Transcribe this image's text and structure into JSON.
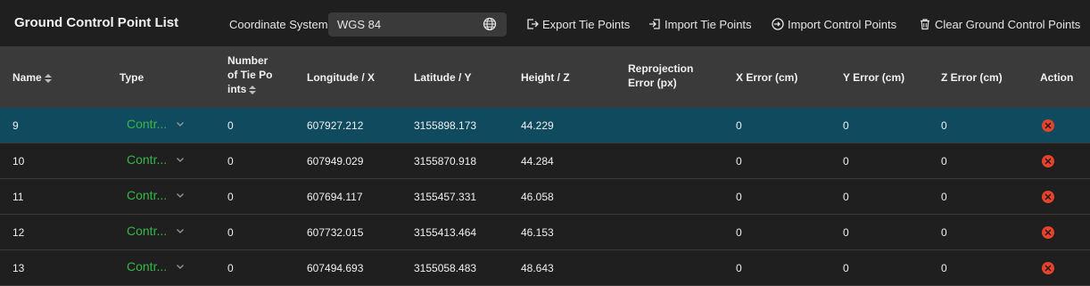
{
  "panel": {
    "title": "Ground Control Point List",
    "coordinate_label": "Coordinate System:",
    "coordinate_value": "WGS 84"
  },
  "toolbar": {
    "export_tie": "Export Tie Points",
    "import_tie": "Import Tie Points",
    "import_control": "Import Control Points",
    "clear_gcp": "Clear Ground Control Points"
  },
  "columns": {
    "name": "Name",
    "type": "Type",
    "tie_points_1": "Number",
    "tie_points_2": "of Tie Po",
    "tie_points_3": "ints",
    "longitude": "Longitude / X",
    "latitude": "Latitude / Y",
    "height": "Height / Z",
    "reproj_1": "Reprojection",
    "reproj_2": "Error (px)",
    "x_error": "X Error (cm)",
    "y_error": "Y Error (cm)",
    "z_error": "Z Error (cm)",
    "action": "Action"
  },
  "rows": [
    {
      "name": "9",
      "type": "Contr...",
      "tie": "0",
      "lon": "607927.212",
      "lat": "3155898.173",
      "h": "44.229",
      "reproj": "",
      "xe": "0",
      "ye": "0",
      "ze": "0"
    },
    {
      "name": "10",
      "type": "Contr...",
      "tie": "0",
      "lon": "607949.029",
      "lat": "3155870.918",
      "h": "44.284",
      "reproj": "",
      "xe": "0",
      "ye": "0",
      "ze": "0"
    },
    {
      "name": "11",
      "type": "Contr...",
      "tie": "0",
      "lon": "607694.117",
      "lat": "3155457.331",
      "h": "46.058",
      "reproj": "",
      "xe": "0",
      "ye": "0",
      "ze": "0"
    },
    {
      "name": "12",
      "type": "Contr...",
      "tie": "0",
      "lon": "607732.015",
      "lat": "3155413.464",
      "h": "46.153",
      "reproj": "",
      "xe": "0",
      "ye": "0",
      "ze": "0"
    },
    {
      "name": "13",
      "type": "Contr...",
      "tie": "0",
      "lon": "607494.693",
      "lat": "3155058.483",
      "h": "48.643",
      "reproj": "",
      "xe": "0",
      "ye": "0",
      "ze": "0"
    }
  ],
  "selected_row": "9",
  "colors": {
    "accent_selected": "#0f4a5f",
    "type_green": "#39b54a",
    "delete_red": "#e5432b"
  },
  "icons": {
    "globe": "globe-icon",
    "export": "export-icon",
    "import": "import-icon",
    "import_control": "import-control-icon",
    "trash": "trash-icon",
    "sort": "sort-icon",
    "delete": "delete-icon"
  }
}
